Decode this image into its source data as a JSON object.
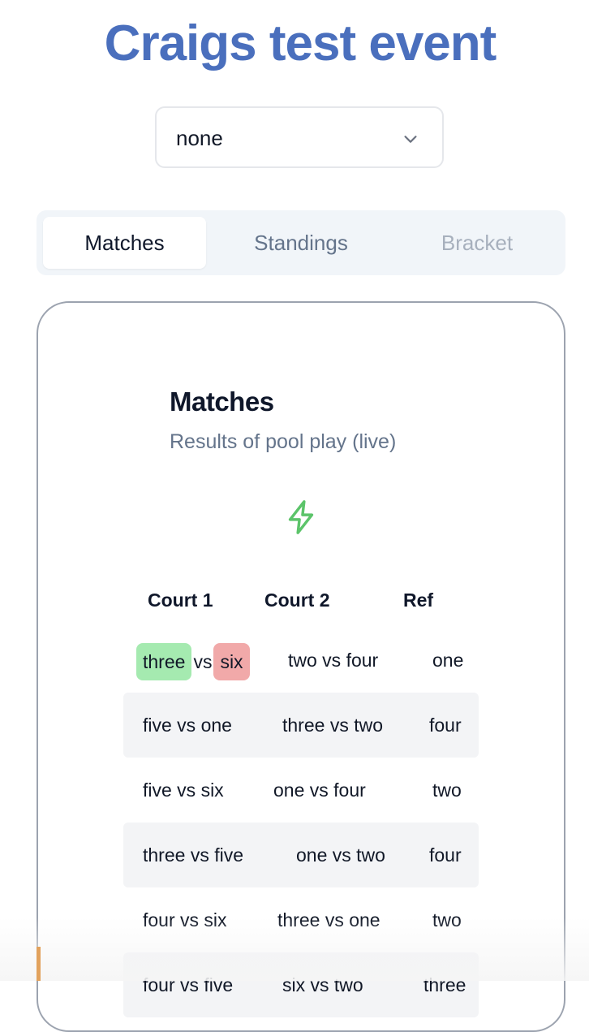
{
  "event": {
    "title": "Craigs test event"
  },
  "filter": {
    "selected": "none",
    "icon": "chevron-down-icon"
  },
  "tabs": [
    {
      "label": "Matches",
      "state": "active"
    },
    {
      "label": "Standings",
      "state": "inactive"
    },
    {
      "label": "Bracket",
      "state": "disabled"
    }
  ],
  "matches_card": {
    "title": "Matches",
    "subtitle": "Results of pool play (live)",
    "live_icon": "lightning-bolt-icon",
    "live_icon_color": "#5cc46a",
    "columns": [
      "Court 1",
      "Court 2",
      "Ref"
    ],
    "first_row": {
      "court1_team_a": "three",
      "court1_vs": "vs",
      "court1_team_b": "six",
      "court2": "two vs four",
      "ref": "one",
      "winner_color": "#a5eab0",
      "loser_color": "#f1a9a9"
    },
    "rows": [
      {
        "court1": "five vs one",
        "court2": "three vs two",
        "ref": "four"
      },
      {
        "court1": "five vs six",
        "court2": "one vs four",
        "ref": "two"
      },
      {
        "court1": "three vs five",
        "court2": "one vs two",
        "ref": "four"
      },
      {
        "court1": "four vs six",
        "court2": "three vs one",
        "ref": "two"
      },
      {
        "court1": "four vs five",
        "court2": "six vs two",
        "ref": "three"
      }
    ]
  },
  "colors": {
    "title_blue": "#4a6fbd",
    "tab_bg": "#f1f5f9",
    "row_alt": "#f3f4f6"
  }
}
